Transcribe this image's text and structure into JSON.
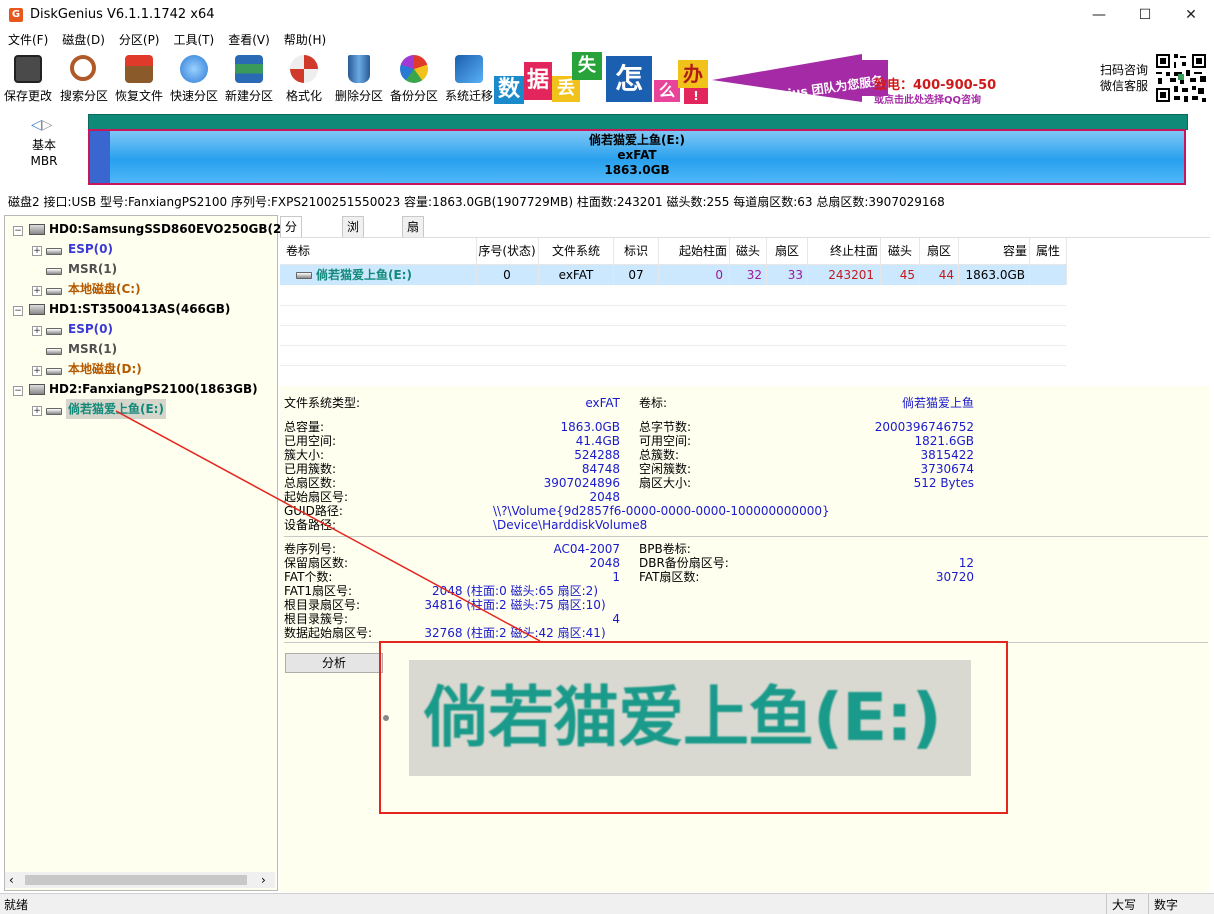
{
  "window": {
    "title": "DiskGenius V6.1.1.1742 x64",
    "app_icon_glyph": "G",
    "minimize": "—",
    "maximize": "☐",
    "close": "✕"
  },
  "menu": [
    "文件(F)",
    "磁盘(D)",
    "分区(P)",
    "工具(T)",
    "查看(V)",
    "帮助(H)"
  ],
  "toolbar": [
    {
      "label": "保存更改",
      "icon": "save-icon",
      "color": "#4a4a4a"
    },
    {
      "label": "搜索分区",
      "icon": "search-partition-icon",
      "color": "#b05a2a"
    },
    {
      "label": "恢复文件",
      "icon": "recover-files-icon",
      "color": "#6b8a3a"
    },
    {
      "label": "快速分区",
      "icon": "quick-partition-icon",
      "color": "#3a8ad5"
    },
    {
      "label": "新建分区",
      "icon": "new-partition-icon",
      "color": "#3a9a5a"
    },
    {
      "label": "格式化",
      "icon": "format-icon",
      "color": "#d03a2a"
    },
    {
      "label": "删除分区",
      "icon": "delete-partition-icon",
      "color": "#3a7ab5"
    },
    {
      "label": "备份分区",
      "icon": "backup-partition-icon",
      "color": "#d5a02a"
    },
    {
      "label": "系统迁移",
      "icon": "system-migration-icon",
      "color": "#2a7ad5"
    }
  ],
  "banner": {
    "tiles": [
      {
        "ch": "数",
        "color": "#1a8acb"
      },
      {
        "ch": "据",
        "color": "#e2255a"
      },
      {
        "ch": "丢",
        "color": "#f0c21a"
      },
      {
        "ch": "失",
        "color": "#27a33a"
      },
      {
        "ch": "怎",
        "color": "#1a5fb0"
      },
      {
        "ch": "么",
        "color": "#e8459a"
      },
      {
        "ch": "办",
        "color": "#f0c21a"
      },
      {
        "ch": "!",
        "color": "#e2255a"
      }
    ],
    "slogan": "DiskGenius 团队为您服务",
    "phone": "致电：400-900-5080",
    "qq": "或点击此处选择QQ咨询"
  },
  "qr": {
    "line1": "扫码咨询",
    "line2": "微信客服"
  },
  "diskmap": {
    "nav_prev": "◁",
    "nav_next": "▷",
    "kind_line1": "基本",
    "kind_line2": "MBR",
    "partition_name": "倘若猫爱上鱼(E:)",
    "partition_fs": "exFAT",
    "partition_size": "1863.0GB"
  },
  "disk_info": "磁盘2 接口:USB  型号:FanxiangPS2100  序列号:FXPS2100251550023  容量:1863.0GB(1907729MB)  柱面数:243201  磁头数:255  每道扇区数:63  总扇区数:3907029168",
  "tree": {
    "disks": [
      {
        "label": "HD0:SamsungSSD860EVO250GB(233",
        "parts": [
          {
            "label": "ESP(0)",
            "color": "#3a3ad5"
          },
          {
            "label": "MSR(1)",
            "color": "#505050"
          },
          {
            "label": "本地磁盘(C:)",
            "color": "#b35a00"
          }
        ]
      },
      {
        "label": "HD1:ST3500413AS(466GB)",
        "parts": [
          {
            "label": "ESP(0)",
            "color": "#3a3ad5"
          },
          {
            "label": "MSR(1)",
            "color": "#505050"
          },
          {
            "label": "本地磁盘(D:)",
            "color": "#b35a00"
          }
        ]
      },
      {
        "label": "HD2:FanxiangPS2100(1863GB)",
        "parts": [
          {
            "label": "倘若猫爱上鱼(E:)",
            "color": "#128a7a"
          }
        ]
      }
    ],
    "expander_minus": "−",
    "expander_plus": "+",
    "scroll_left": "‹",
    "scroll_right": "›"
  },
  "tabs": [
    "分区参数",
    "浏览文件",
    "扇区编辑"
  ],
  "table": {
    "columns": [
      "卷标",
      "序号(状态)",
      "文件系统",
      "标识",
      "起始柱面",
      "磁头",
      "扇区",
      "终止柱面",
      "磁头",
      "扇区",
      "容量",
      "属性"
    ],
    "row": [
      "倘若猫爱上鱼(E:)",
      "0",
      "exFAT",
      "07",
      "0",
      "32",
      "33",
      "243201",
      "45",
      "44",
      "1863.0GB",
      ""
    ]
  },
  "details": {
    "fs_type_label": "文件系统类型:",
    "fs_type": "exFAT",
    "volume_label_label": "卷标:",
    "volume_label": "倘若猫爱上鱼",
    "left1": [
      {
        "k": "总容量:",
        "v": "1863.0GB"
      },
      {
        "k": "已用空间:",
        "v": "41.4GB"
      },
      {
        "k": "簇大小:",
        "v": "524288"
      },
      {
        "k": "已用簇数:",
        "v": "84748"
      },
      {
        "k": "总扇区数:",
        "v": "3907024896"
      },
      {
        "k": "起始扇区号:",
        "v": "2048"
      }
    ],
    "right1": [
      {
        "k": "总字节数:",
        "v": "2000396746752"
      },
      {
        "k": "可用空间:",
        "v": "1821.6GB"
      },
      {
        "k": "总簇数:",
        "v": "3815422"
      },
      {
        "k": "空闲簇数:",
        "v": "3730674"
      },
      {
        "k": "扇区大小:",
        "v": "512 Bytes"
      }
    ],
    "guid_label": "GUID路径:",
    "guid": "\\\\?\\Volume{9d2857f6-0000-0000-0000-100000000000}",
    "device_label": "设备路径:",
    "device": "\\Device\\HarddiskVolume8",
    "left2": [
      {
        "k": "卷序列号:",
        "v": "AC04-2007"
      },
      {
        "k": "保留扇区数:",
        "v": "2048"
      },
      {
        "k": "FAT个数:",
        "v": "1"
      },
      {
        "k": "FAT1扇区号:",
        "v": "2048 (柱面:0 磁头:65 扇区:2)"
      },
      {
        "k": "根目录扇区号:",
        "v": "34816 (柱面:2 磁头:75 扇区:10)"
      },
      {
        "k": "根目录簇号:",
        "v": "4"
      },
      {
        "k": "数据起始扇区号:",
        "v": "32768 (柱面:2 磁头:42 扇区:41)"
      }
    ],
    "right2": [
      {
        "k": "BPB卷标:",
        "v": ""
      },
      {
        "k": "DBR备份扇区号:",
        "v": "12"
      },
      {
        "k": "FAT扇区数:",
        "v": "30720"
      }
    ],
    "analyze_button": "分析"
  },
  "zoom_callout": {
    "text": "倘若猫爱上鱼(E:)",
    "border_color": "#e5261e"
  },
  "status": {
    "left": "就绪",
    "caps": "大写",
    "num": "数字"
  }
}
